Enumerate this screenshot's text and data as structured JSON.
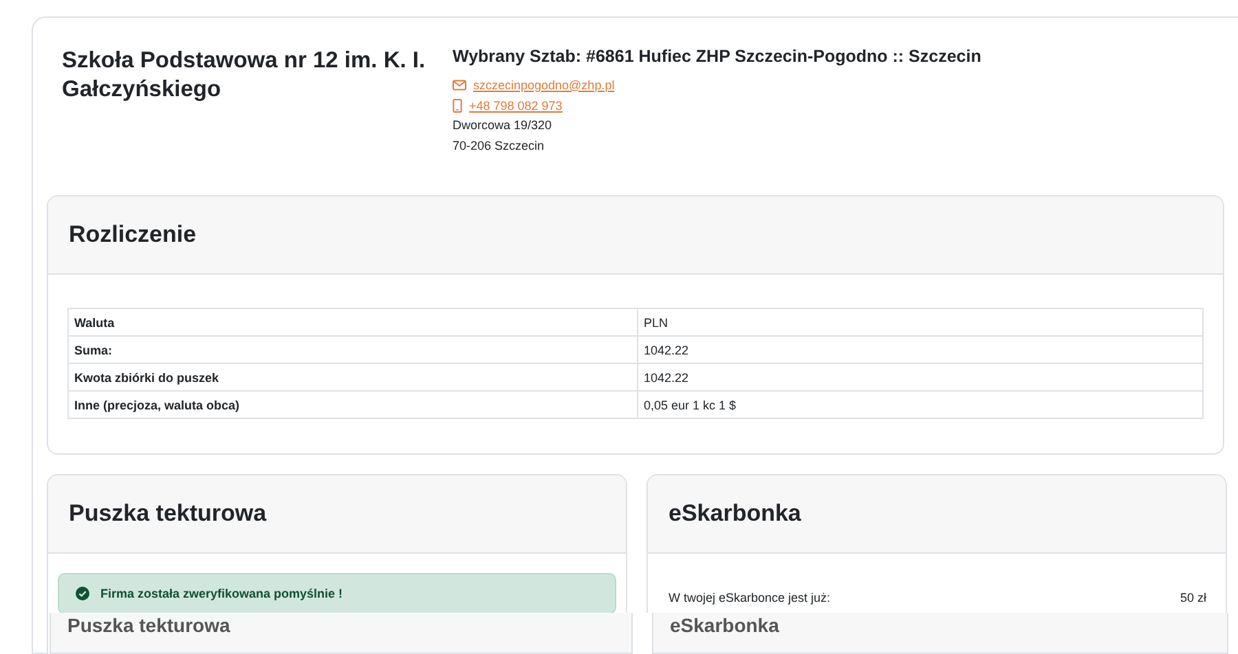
{
  "school": {
    "name": "Szkoła Podstawowa nr 12 im. K. I. Gałczyńskiego"
  },
  "unit": {
    "title": "Wybrany Sztab: #6861 Hufiec ZHP Szczecin-Pogodno :: Szczecin",
    "email": "szczecinpogodno@zhp.pl",
    "phone": "+48 798 082 973",
    "address_lines": [
      "Dworcowa 19/320",
      "70-206 Szczecin"
    ]
  },
  "settlement": {
    "title": "Rozliczenie",
    "rows": [
      {
        "label": "Waluta",
        "value": "PLN"
      },
      {
        "label": "Suma:",
        "value": "1042.22"
      },
      {
        "label": "Kwota zbiórki do puszek",
        "value": "1042.22"
      },
      {
        "label": "Inne (precjoza, waluta obca)",
        "value": "0,05 eur 1 kc 1 $"
      }
    ]
  },
  "cards": [
    {
      "kind": "alert",
      "title": "Puszka tekturowa",
      "text": "Firma została zweryfikowana pomyślnie !"
    },
    {
      "kind": "balance",
      "title": "eSkarbonka",
      "label": "W twojej eSkarbonce jest już:",
      "value": "50 zł"
    }
  ],
  "overlap_headers": [
    {
      "title": "Puszka tekturowa"
    },
    {
      "title": "eSkarbonka"
    }
  ]
}
